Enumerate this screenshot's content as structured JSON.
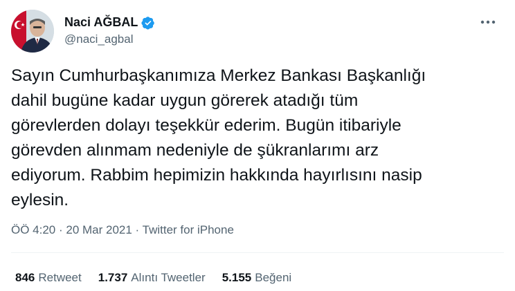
{
  "author": {
    "display_name": "Naci AĞBAL",
    "handle": "@naci_agbal",
    "verified": true,
    "avatar_icon": "profile-photo-with-turkish-flag"
  },
  "tweet": {
    "text": "Sayın Cumhurbaşkanımıza Merkez Bankası Başkanlığı\ndahil bugüne kadar uygun görerek atadığı tüm\ngörevlerden dolayı teşekkür ederim. Bugün itibariyle\ngörevden alınmam nedeniyle de şükranlarımı arz\nediyorum. Rabbim hepimizin hakkında hayırlısını nasip\neylesin."
  },
  "meta": {
    "time": "ÖÖ 4:20",
    "sep1": " · ",
    "date": "20 Mar 2021",
    "sep2": " · ",
    "source": "Twitter for iPhone"
  },
  "stats": {
    "retweets_count": "846",
    "retweets_label": "Retweet",
    "quotes_count": "1.737",
    "quotes_label": "Alıntı Tweetler",
    "likes_count": "5.155",
    "likes_label": "Beğeni"
  },
  "colors": {
    "accent": "#1d9bf0",
    "text": "#0f1419",
    "secondary": "#536471",
    "divider": "#eff3f4"
  }
}
